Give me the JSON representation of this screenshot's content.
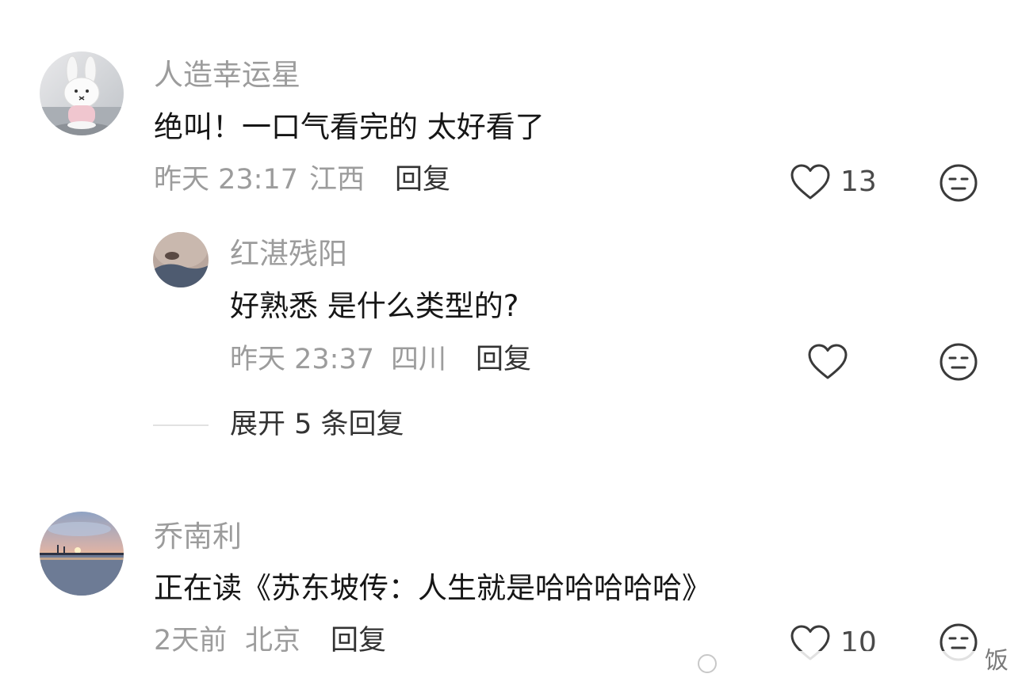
{
  "comments": [
    {
      "username": "人造幸运星",
      "text": "绝叫！一口气看完的 太好看了",
      "time": "昨天 23:17",
      "location": "江西",
      "reply_label": "回复",
      "likes": "13"
    },
    {
      "username": "乔南利",
      "text": "正在读《苏东坡传：人生就是哈哈哈哈哈》",
      "time": "2天前",
      "location": "北京",
      "reply_label": "回复",
      "likes": "10"
    }
  ],
  "sub_reply": {
    "username": "红湛残阳",
    "text": "好熟悉 是什么类型的?",
    "time": "昨天 23:37",
    "location": "四川",
    "reply_label": "回复"
  },
  "expand_replies": "展开 5 条回复",
  "watermark": "饭",
  "colors": {
    "secondary_text": "#9c9c9c",
    "primary_text": "#161616",
    "icon_stroke": "#3a3a3a"
  }
}
